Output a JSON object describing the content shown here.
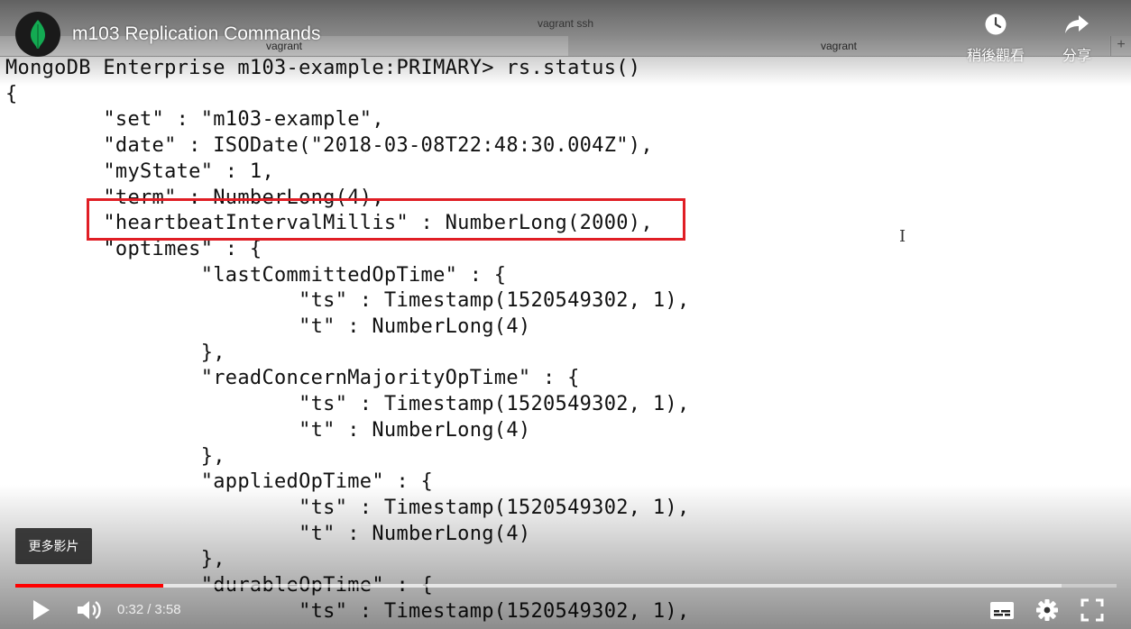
{
  "terminal": {
    "window_title": "vagrant ssh",
    "tabs": [
      {
        "label": "vagrant"
      },
      {
        "label": "vagrant"
      }
    ],
    "add_tab_label": "+",
    "lines": [
      "MongoDB Enterprise m103-example:PRIMARY> rs.status()",
      "{",
      "        \"set\" : \"m103-example\",",
      "        \"date\" : ISODate(\"2018-03-08T22:48:30.004Z\"),",
      "        \"myState\" : 1,",
      "        \"term\" : NumberLong(4),",
      "        \"heartbeatIntervalMillis\" : NumberLong(2000),",
      "        \"optimes\" : {",
      "                \"lastCommittedOpTime\" : {",
      "                        \"ts\" : Timestamp(1520549302, 1),",
      "                        \"t\" : NumberLong(4)",
      "                },",
      "                \"readConcernMajorityOpTime\" : {",
      "                        \"ts\" : Timestamp(1520549302, 1),",
      "                        \"t\" : NumberLong(4)",
      "                },",
      "                \"appliedOpTime\" : {",
      "                        \"ts\" : Timestamp(1520549302, 1),",
      "                        \"t\" : NumberLong(4)",
      "                },",
      "                \"durableOpTime\" : {",
      "                        \"ts\" : Timestamp(1520549302, 1),"
    ],
    "highlight_color": "#e01e25"
  },
  "player": {
    "title": "m103 Replication Commands",
    "channel_avatar_icon": "mongodb-leaf-icon",
    "watch_later_label": "稍後觀看",
    "share_label": "分享",
    "more_videos_label": "更多影片",
    "current_time": "0:32",
    "time_separator": "/",
    "duration": "3:58",
    "progress_played_fraction": 0.134,
    "progress_loaded_fraction": 0.95,
    "progress_color": "#ff0000",
    "controls": {
      "play_icon": "play-icon",
      "volume_icon": "volume-icon",
      "captions_icon": "captions-icon",
      "settings_icon": "settings-gear-icon",
      "fullscreen_icon": "fullscreen-icon"
    }
  }
}
